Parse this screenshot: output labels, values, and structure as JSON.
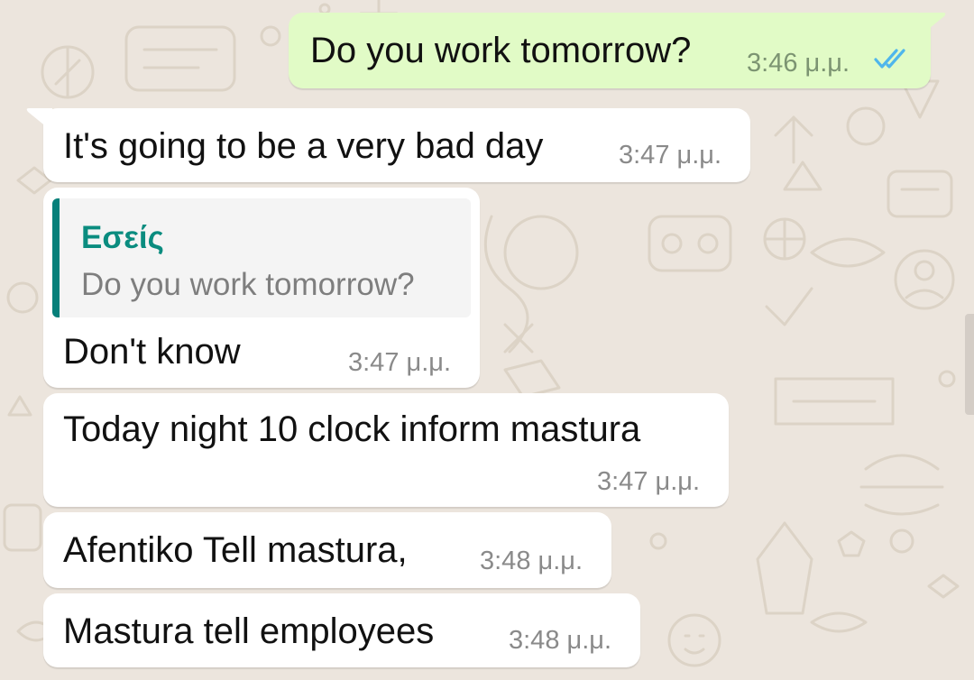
{
  "conversation": {
    "messages": [
      {
        "direction": "outgoing",
        "text": "Do you work tomorrow?",
        "time": "3:46 μ.μ.",
        "status": "read"
      },
      {
        "direction": "incoming",
        "text": "It's going to be a very bad day",
        "time": "3:47 μ.μ."
      },
      {
        "direction": "incoming",
        "text": "Don't know",
        "time": "3:47 μ.μ.",
        "reply_to": {
          "author": "Εσείς",
          "text": "Do you work tomorrow?"
        }
      },
      {
        "direction": "incoming",
        "text": "Today night 10 clock inform mastura",
        "time": "3:47 μ.μ."
      },
      {
        "direction": "incoming",
        "text": "Afentiko Tell mastura,",
        "time": "3:48 μ.μ."
      },
      {
        "direction": "incoming",
        "text": "Mastura tell employees",
        "time": "3:48 μ.μ."
      }
    ]
  },
  "icons": {
    "read_receipt": "double-check-icon"
  },
  "colors": {
    "wallpaper": "#ece5dd",
    "incoming_bubble": "#ffffff",
    "outgoing_bubble": "#e1fbc6",
    "read_ticks": "#4fb6ec",
    "quote_accent": "#07807a",
    "quote_author": "#0a8c7f"
  }
}
